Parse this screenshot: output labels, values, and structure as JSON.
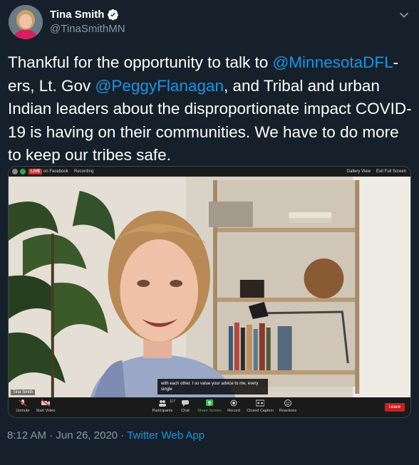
{
  "author": {
    "display_name": "Tina Smith",
    "handle": "@TinaSmithMN",
    "avatar_icon": "avatar-photo",
    "verified_icon": "verified-badge-icon"
  },
  "tweet": {
    "segments": [
      {
        "type": "text",
        "value": "Thankful for the opportunity to talk to "
      },
      {
        "type": "mention",
        "value": "@MinnesotaDFL"
      },
      {
        "type": "text",
        "value": "-ers, Lt. Gov "
      },
      {
        "type": "mention",
        "value": "@PeggyFlanagan"
      },
      {
        "type": "text",
        "value": ", and Tribal and urban Indian leaders about the disproportionate impact COVID-19 is having on their communities. We have to do more to keep our tribes safe."
      }
    ]
  },
  "video": {
    "top_bar": {
      "live_label": "LIVE",
      "stream_label": "on Facebook",
      "recording_label": "Recording",
      "gallery_view_label": "Gallery View",
      "exit_full_screen_label": "Exit Full Screen"
    },
    "participant_name": "Tina Smith",
    "caption_text": "with each other. I so value your advice to me, every single",
    "toolbar": {
      "unmute_label": "Unmute",
      "start_video_label": "Start Video",
      "participants_label": "Participants",
      "participants_count": "117",
      "chat_label": "Chat",
      "share_screen_label": "Share Screen",
      "record_label": "Record",
      "closed_caption_label": "Closed Caption",
      "reactions_label": "Reactions",
      "leave_label": "Leave"
    }
  },
  "meta": {
    "time": "8:12 AM",
    "date": "Jun 26, 2020",
    "separator": " · ",
    "app": "Twitter Web App"
  },
  "colors": {
    "background": "#15202b",
    "link": "#1b95e0",
    "secondary_text": "#8899a6",
    "leave_red": "#c8201f"
  }
}
